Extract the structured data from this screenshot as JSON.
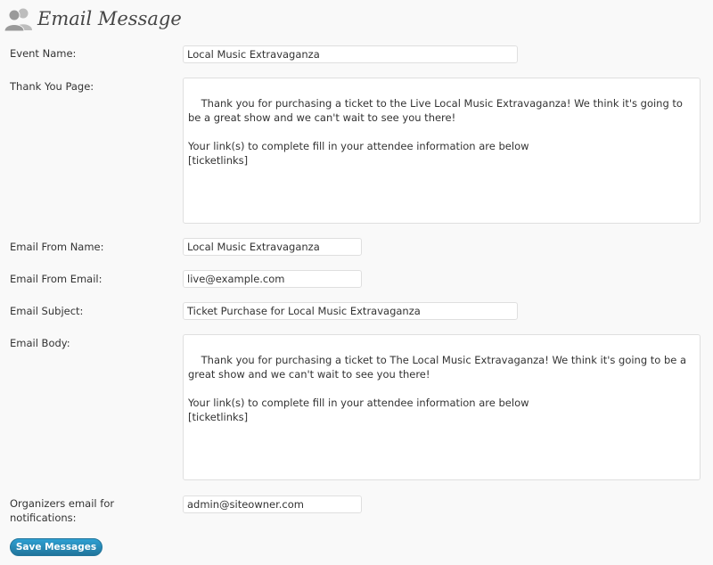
{
  "header": {
    "title": "Email Message",
    "icon": "users-icon"
  },
  "fields": {
    "event_name": {
      "label": "Event Name:",
      "value": "Local Music Extravaganza"
    },
    "thank_you_page": {
      "label": "Thank You Page:",
      "value": "Thank you for purchasing a ticket to the Live Local Music Extravaganza! We think it's going to be a great show and we can't wait to see you there!\n\nYour link(s) to complete fill in your attendee information are below\n[ticketlinks]"
    },
    "email_from_name": {
      "label": "Email From Name:",
      "value": "Local Music Extravaganza"
    },
    "email_from_email": {
      "label": "Email From Email:",
      "value": "live@example.com"
    },
    "email_subject": {
      "label": "Email Subject:",
      "value": "Ticket Purchase for Local Music Extravaganza"
    },
    "email_body": {
      "label": "Email Body:",
      "value": "Thank you for purchasing a ticket to The Local Music Extravaganza! We think it's going to be a great show and we can't wait to see you there!\n\nYour link(s) to complete fill in your attendee information are below\n[ticketlinks]"
    },
    "organizers_email": {
      "label": "Organizers email for notifications:",
      "value": "admin@siteowner.com"
    }
  },
  "actions": {
    "save_label": "Save Messages"
  },
  "colors": {
    "button": "#21759b",
    "background": "#f9f9f9",
    "border": "#dfdfdf"
  }
}
